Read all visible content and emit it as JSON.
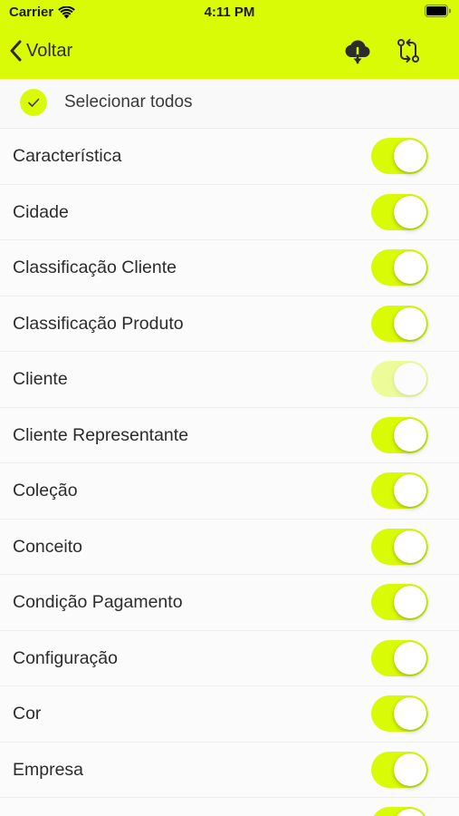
{
  "colors": {
    "accent": "#d9fb06",
    "header_bg": "#d9fb06",
    "icon_dark": "#2c2c2e"
  },
  "status_bar": {
    "carrier": "Carrier",
    "time": "4:11 PM",
    "wifi_icon": "wifi-icon",
    "battery_icon": "battery-icon"
  },
  "nav": {
    "back_label": "Voltar",
    "back_icon": "chevron-left-icon",
    "download_icon": "cloud-download-icon",
    "sync_icon": "sync-icon"
  },
  "select_all": {
    "label": "Selecionar todos",
    "checked": true
  },
  "items": [
    {
      "label": "Característica",
      "on": true,
      "enabled": true
    },
    {
      "label": "Cidade",
      "on": true,
      "enabled": true
    },
    {
      "label": "Classificação Cliente",
      "on": true,
      "enabled": true
    },
    {
      "label": "Classificação Produto",
      "on": true,
      "enabled": true
    },
    {
      "label": "Cliente",
      "on": true,
      "enabled": false
    },
    {
      "label": "Cliente Representante",
      "on": true,
      "enabled": true
    },
    {
      "label": "Coleção",
      "on": true,
      "enabled": true
    },
    {
      "label": "Conceito",
      "on": true,
      "enabled": true
    },
    {
      "label": "Condição Pagamento",
      "on": true,
      "enabled": true
    },
    {
      "label": "Configuração",
      "on": true,
      "enabled": true
    },
    {
      "label": "Cor",
      "on": true,
      "enabled": true
    },
    {
      "label": "Empresa",
      "on": true,
      "enabled": true
    },
    {
      "label": "",
      "on": true,
      "enabled": true
    }
  ]
}
